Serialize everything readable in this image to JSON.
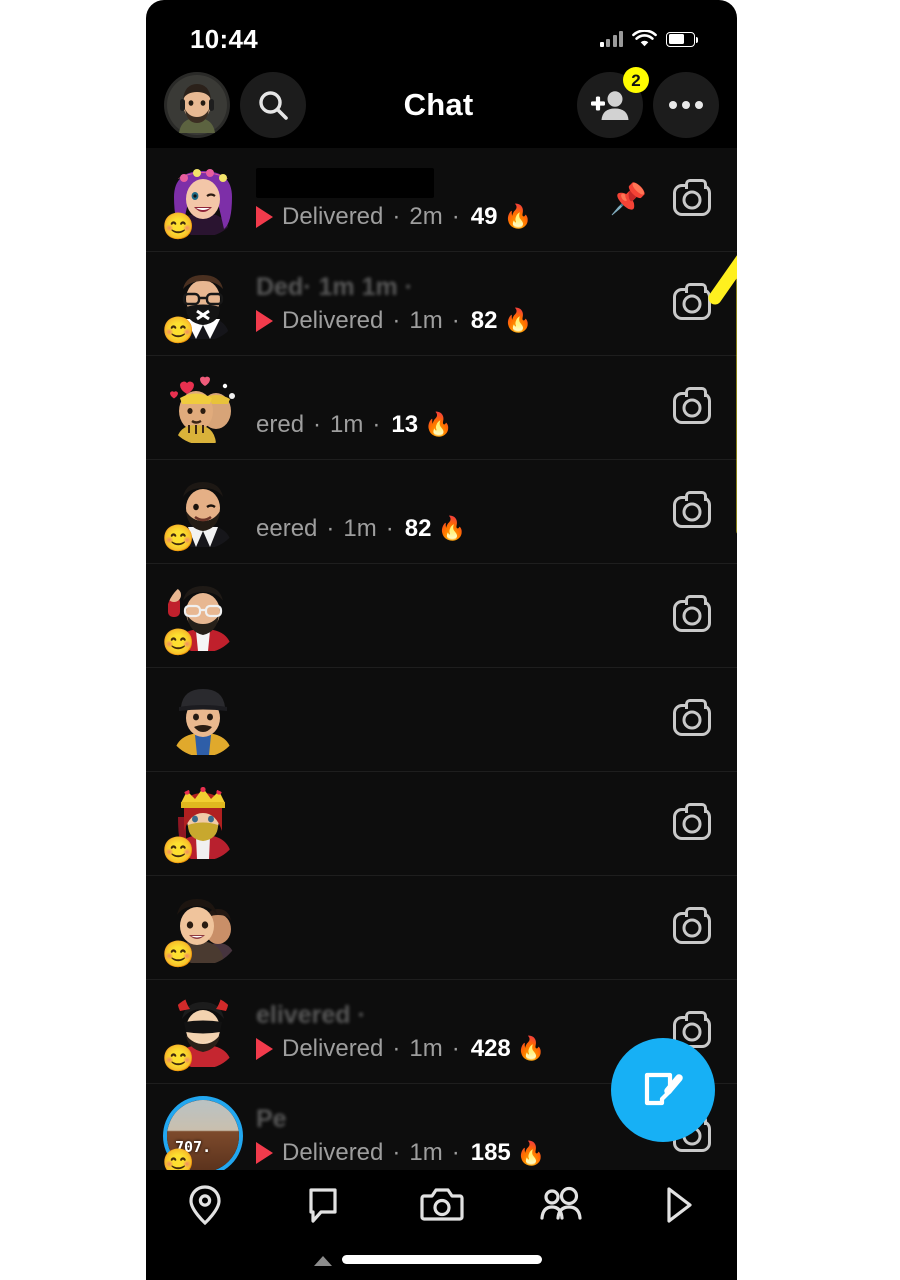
{
  "status_bar": {
    "time": "10:44",
    "signal_icon": "cellular-signal-icon",
    "wifi_icon": "wifi-icon",
    "battery_icon": "battery-icon",
    "battery_level_pct": 65
  },
  "header": {
    "title": "Chat",
    "profile_avatar": "profile-bitmoji-avatar",
    "search_icon": "search-icon",
    "add_friend_icon": "add-friend-icon",
    "add_friend_badge": "2",
    "more_icon": "more-options-icon",
    "badge_color": "#FFFC00"
  },
  "chat_list": {
    "rows": [
      {
        "name": "",
        "name_state": "redacted",
        "status": "Delivered",
        "time": "2m",
        "streak": "49",
        "fire": "🔥",
        "sent_arrow": true,
        "pinned": true,
        "pin_icon": "📌",
        "avatar": "bitmoji-purple-hair-flower-crown",
        "friend_emoji": "😊",
        "camera_icon": "camera-icon",
        "visible": true
      },
      {
        "name": "Ded· 1m 1m ·",
        "name_state": "faded",
        "status": "Delivered",
        "time": "1m",
        "streak": "82",
        "fire": "🔥",
        "sent_arrow": true,
        "pinned": false,
        "avatar": "bitmoji-glasses-black-mask",
        "friend_emoji": "😊",
        "camera_icon": "camera-icon",
        "visible": true
      },
      {
        "name": "",
        "name_state": "dim",
        "status": "ered",
        "time": "1m",
        "streak": "13",
        "fire": "🔥",
        "sent_arrow": false,
        "pinned": false,
        "avatar": "bitmoji-group-hearts-crown",
        "friend_emoji": "",
        "camera_icon": "camera-icon",
        "visible": true
      },
      {
        "name": "",
        "name_state": "dim",
        "status": "eered",
        "time": "1m",
        "streak": "82",
        "fire": "🔥",
        "sent_arrow": false,
        "pinned": false,
        "avatar": "bitmoji-beard-suit-wink",
        "friend_emoji": "😊",
        "camera_icon": "camera-icon",
        "visible": true
      },
      {
        "name": "",
        "name_state": "ghost",
        "status": "",
        "time": "",
        "streak": "",
        "fire": "",
        "sent_arrow": false,
        "pinned": false,
        "avatar": "bitmoji-red-hoodie-glasses-fist",
        "friend_emoji": "😊",
        "camera_icon": "camera-icon",
        "visible": false
      },
      {
        "name": "",
        "name_state": "ghost",
        "status": "",
        "time": "",
        "streak": "",
        "fire": "",
        "sent_arrow": false,
        "pinned": false,
        "avatar": "bitmoji-cap-mustache-yellow-shirt",
        "friend_emoji": "",
        "camera_icon": "camera-icon",
        "visible": false
      },
      {
        "name": "",
        "name_state": "ghost",
        "status": "",
        "time": "",
        "streak": "",
        "fire": "",
        "sent_arrow": false,
        "pinned": false,
        "avatar": "bitmoji-queen-crown-red-robe",
        "friend_emoji": "😊",
        "camera_icon": "camera-icon",
        "visible": false
      },
      {
        "name": "",
        "name_state": "ghost",
        "status": "",
        "time": "",
        "streak": "",
        "fire": "",
        "sent_arrow": false,
        "pinned": false,
        "avatar": "bitmoji-couple-smiling",
        "friend_emoji": "😊",
        "camera_icon": "camera-icon",
        "visible": false
      },
      {
        "name": "elivered ·",
        "name_state": "faded",
        "status": "Delivered",
        "time": "1m",
        "streak": "428",
        "fire": "🔥",
        "sent_arrow": true,
        "pinned": false,
        "avatar": "bitmoji-devil-horns-sunglasses",
        "friend_emoji": "😊",
        "camera_icon": "camera-icon",
        "visible": true
      },
      {
        "name": "Pe",
        "name_state": "faded",
        "status": "Delivered",
        "time": "1m",
        "streak": "185",
        "fire": "🔥",
        "sent_arrow": true,
        "pinned": false,
        "avatar": "story-ring-photo-avatar",
        "story_ring": true,
        "story_temp": "707.",
        "friend_emoji": "😊",
        "camera_icon": "camera-icon",
        "visible": true
      }
    ]
  },
  "fab": {
    "icon": "new-chat-compose-icon",
    "color": "#17B0F5"
  },
  "bottom_nav": {
    "items": [
      {
        "icon": "map-location-pin-icon",
        "active": false
      },
      {
        "icon": "chat-bubble-icon",
        "active": true
      },
      {
        "icon": "camera-icon",
        "active": false
      },
      {
        "icon": "friends-people-icon",
        "active": false
      },
      {
        "icon": "spotlight-play-icon",
        "active": false
      }
    ]
  },
  "annotation": {
    "arrow": "yellow-up-arrow-annotation",
    "color": "#FFF01F",
    "points_to": "pin-icon"
  }
}
